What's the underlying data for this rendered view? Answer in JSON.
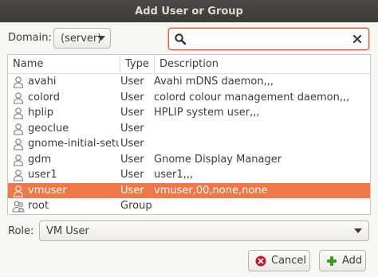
{
  "window": {
    "title": "Add User or Group"
  },
  "domain": {
    "label": "Domain:",
    "value": "(server)"
  },
  "search": {
    "value": "",
    "placeholder": ""
  },
  "table": {
    "headers": {
      "name": "Name",
      "type": "Type",
      "description": "Description"
    },
    "rows": [
      {
        "name": "avahi",
        "type": "User",
        "description": "Avahi mDNS daemon,,,"
      },
      {
        "name": "colord",
        "type": "User",
        "description": "colord colour management daemon,,,"
      },
      {
        "name": "hplip",
        "type": "User",
        "description": "HPLIP system user,,,"
      },
      {
        "name": "geoclue",
        "type": "User",
        "description": ""
      },
      {
        "name": "gnome-initial-setup",
        "type": "User",
        "description": ""
      },
      {
        "name": "gdm",
        "type": "User",
        "description": "Gnome Display Manager"
      },
      {
        "name": "user1",
        "type": "User",
        "description": "user1,,,"
      },
      {
        "name": "vmuser",
        "type": "User",
        "description": "vmuser,00,none,none",
        "selected": true
      },
      {
        "name": "root",
        "type": "Group",
        "description": ""
      }
    ]
  },
  "role": {
    "label": "Role:",
    "value": "VM User"
  },
  "buttons": {
    "cancel": "Cancel",
    "add": "Add"
  },
  "icons": {
    "search": "search-icon",
    "clear": "clear-icon",
    "user": "user-icon",
    "group": "group-icon",
    "cancel": "cancel-icon",
    "add": "plus-icon"
  },
  "colors": {
    "selection": "#f07746",
    "accent": "#e95420",
    "titlebar": "#3c3b37",
    "add_icon": "#3f9b17",
    "cancel_icon": "#c7162b"
  }
}
